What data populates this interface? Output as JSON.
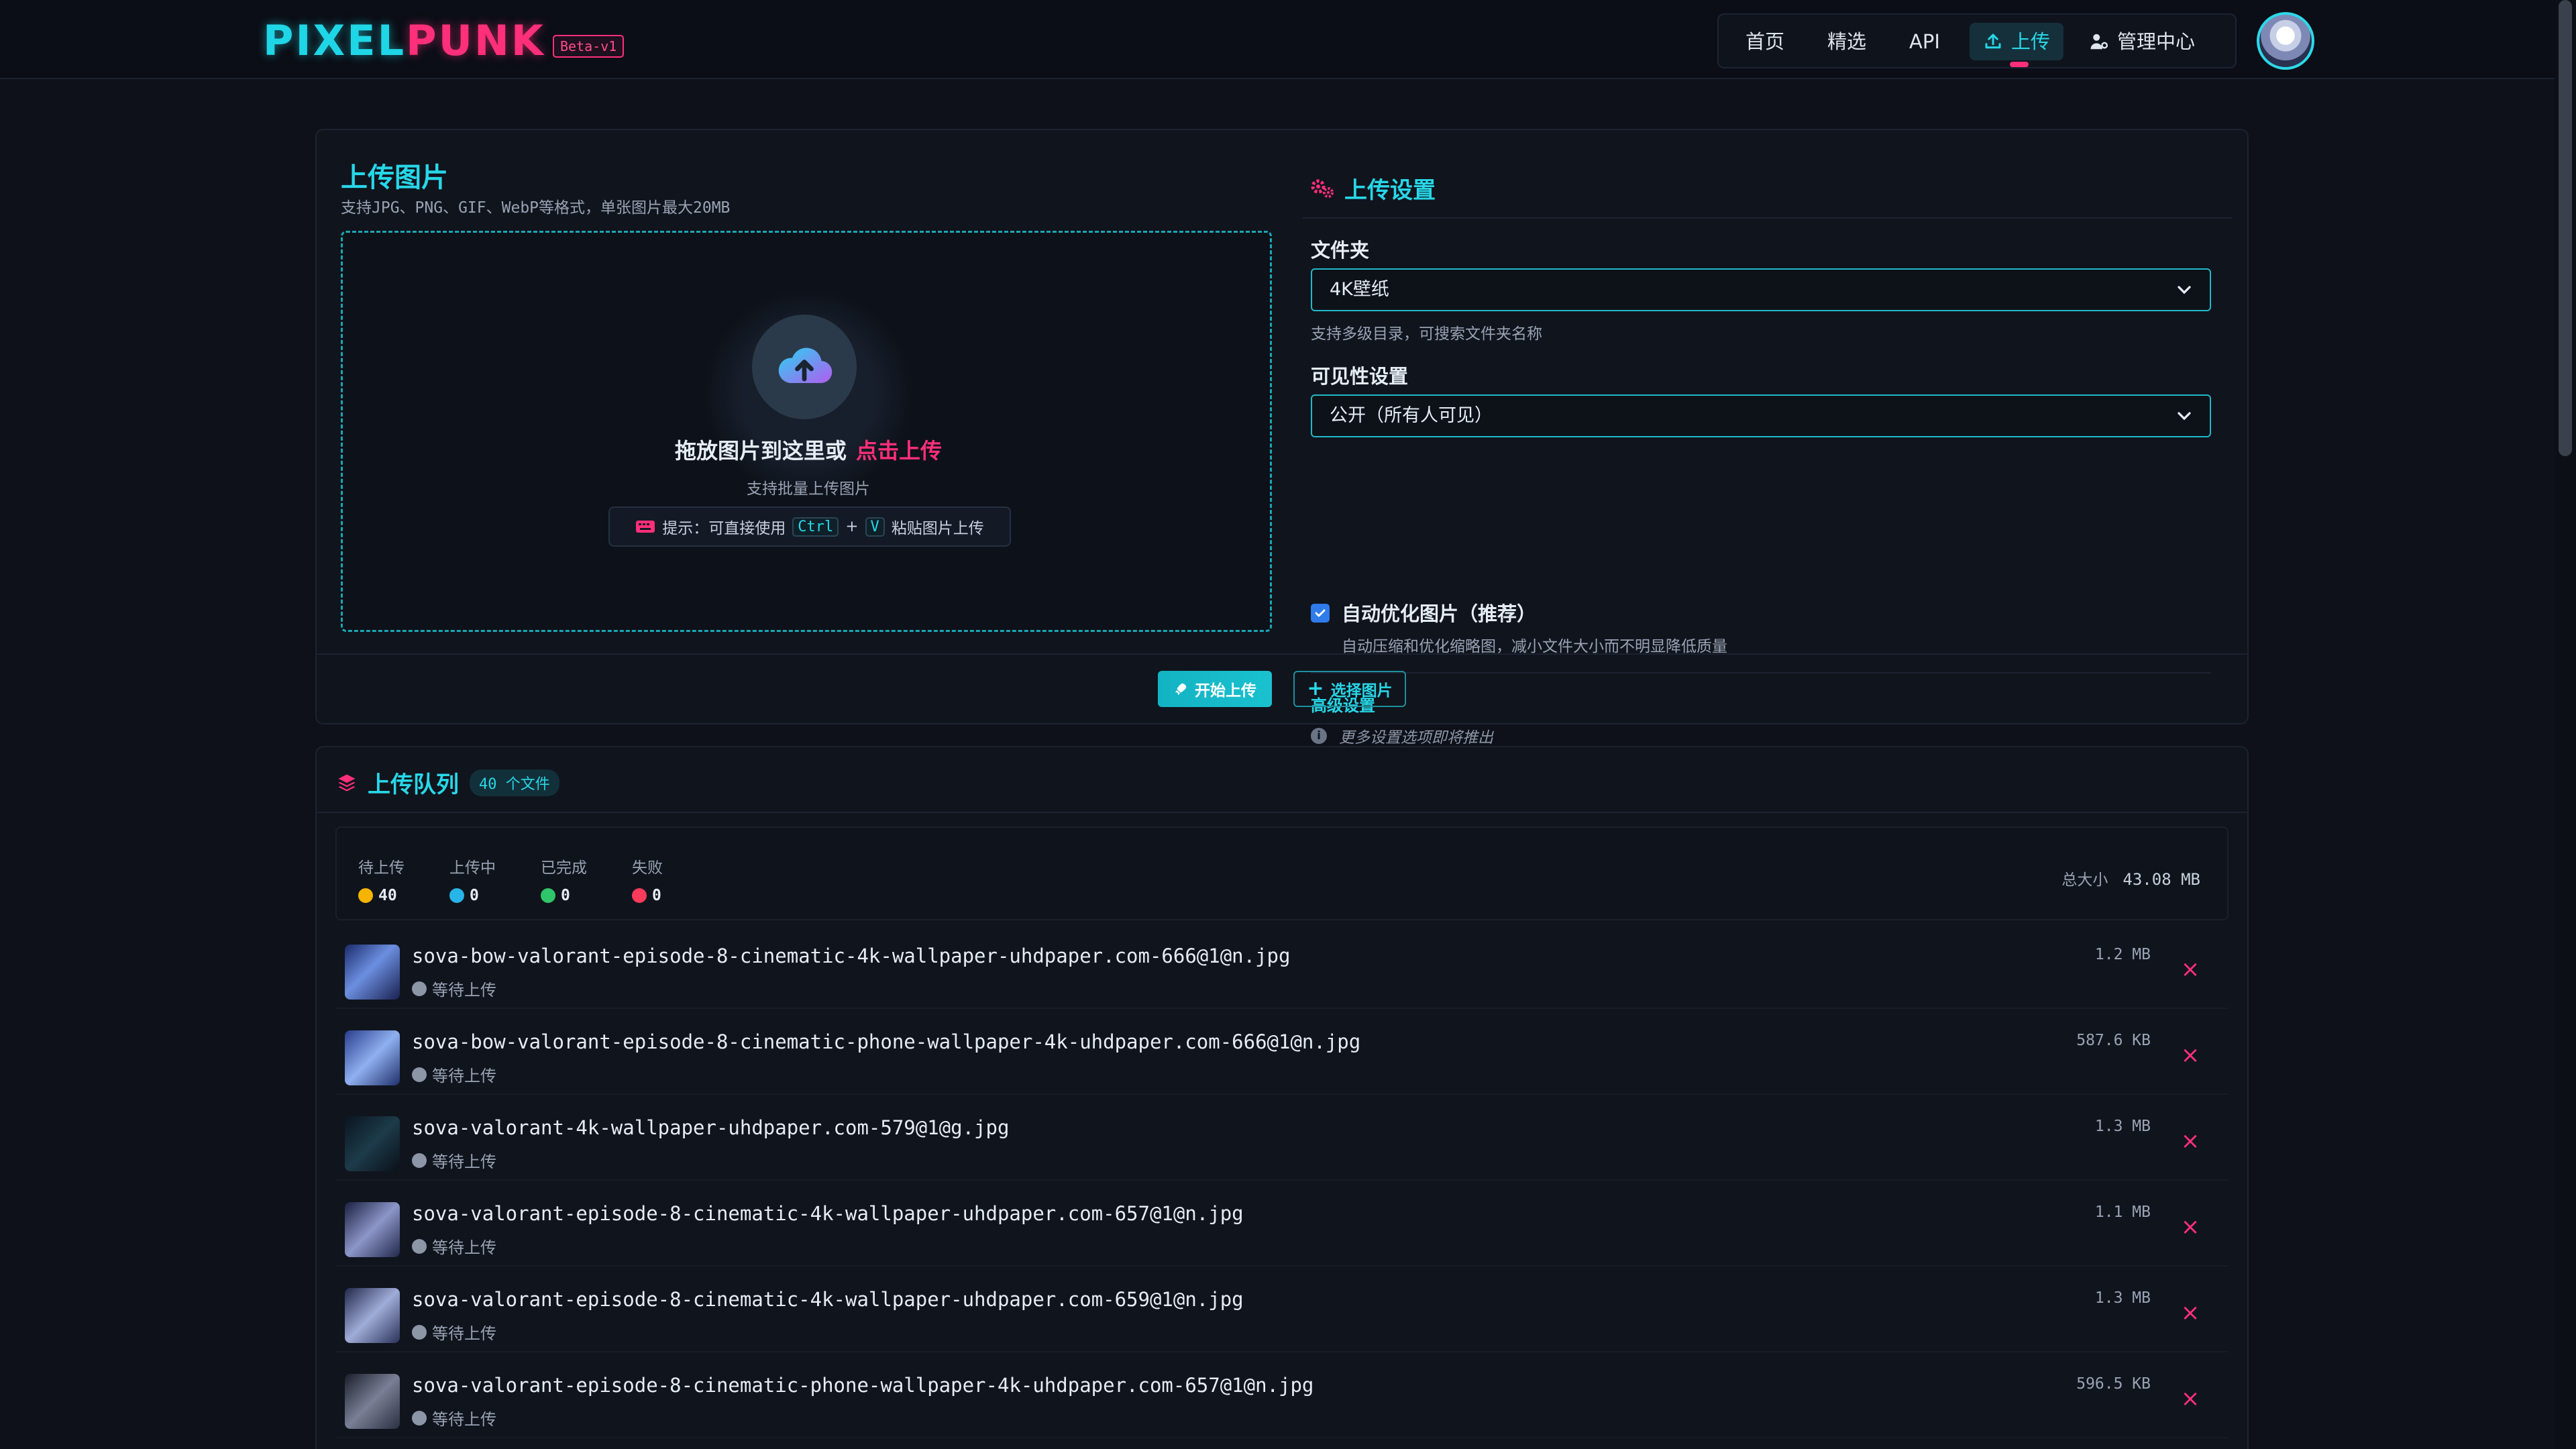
{
  "brand": {
    "logo_part1": "PIXEL",
    "logo_part2": "PUNK",
    "badge": "Beta-v1"
  },
  "nav": {
    "items": [
      {
        "label": "首页"
      },
      {
        "label": "精选"
      },
      {
        "label": "API"
      },
      {
        "label": "上传",
        "active": true
      },
      {
        "label": "管理中心"
      }
    ]
  },
  "upload": {
    "title": "上传图片",
    "subtitle": "支持JPG、PNG、GIF、WebP等格式，单张图片最大20MB",
    "drop_text": "拖放图片到这里或",
    "drop_link": "点击上传",
    "drop_sub": "支持批量上传图片",
    "hint_prefix": "提示：可直接使用",
    "hint_key1": "Ctrl",
    "hint_plus": "+",
    "hint_key2": "V",
    "hint_suffix": "粘贴图片上传"
  },
  "settings": {
    "title": "上传设置",
    "folder_label": "文件夹",
    "folder_value": "4K壁纸",
    "folder_help": "支持多级目录，可搜索文件夹名称",
    "visibility_label": "可见性设置",
    "visibility_value": "公开（所有人可见）",
    "optimize_label": "自动优化图片（推荐）",
    "optimize_checked": true,
    "optimize_help": "自动压缩和优化缩略图，减小文件大小而不明显降低质量",
    "advanced_title": "高级设置",
    "advanced_note": "更多设置选项即将推出"
  },
  "actions": {
    "start": "开始上传",
    "select": "选择图片"
  },
  "queue": {
    "title": "上传队列",
    "count_badge": "40 个文件",
    "stats": [
      {
        "label": "待上传",
        "value": "40",
        "color": "#f5b400"
      },
      {
        "label": "上传中",
        "value": "0",
        "color": "#27b4e8"
      },
      {
        "label": "已完成",
        "value": "0",
        "color": "#2fc56a"
      },
      {
        "label": "失败",
        "value": "0",
        "color": "#ff3b5c"
      }
    ],
    "total_label": "总大小",
    "total_value": "43.08 MB",
    "files": [
      {
        "name": "sova-bow-valorant-episode-8-cinematic-4k-wallpaper-uhdpaper.com-666@1@n.jpg",
        "status": "等待上传",
        "size": "1.2 MB"
      },
      {
        "name": "sova-bow-valorant-episode-8-cinematic-phone-wallpaper-4k-uhdpaper.com-666@1@n.jpg",
        "status": "等待上传",
        "size": "587.6 KB"
      },
      {
        "name": "sova-valorant-4k-wallpaper-uhdpaper.com-579@1@g.jpg",
        "status": "等待上传",
        "size": "1.3 MB"
      },
      {
        "name": "sova-valorant-episode-8-cinematic-4k-wallpaper-uhdpaper.com-657@1@n.jpg",
        "status": "等待上传",
        "size": "1.1 MB"
      },
      {
        "name": "sova-valorant-episode-8-cinematic-4k-wallpaper-uhdpaper.com-659@1@n.jpg",
        "status": "等待上传",
        "size": "1.3 MB"
      },
      {
        "name": "sova-valorant-episode-8-cinematic-phone-wallpaper-4k-uhdpaper.com-657@1@n.jpg",
        "status": "等待上传",
        "size": "596.5 KB"
      }
    ]
  }
}
